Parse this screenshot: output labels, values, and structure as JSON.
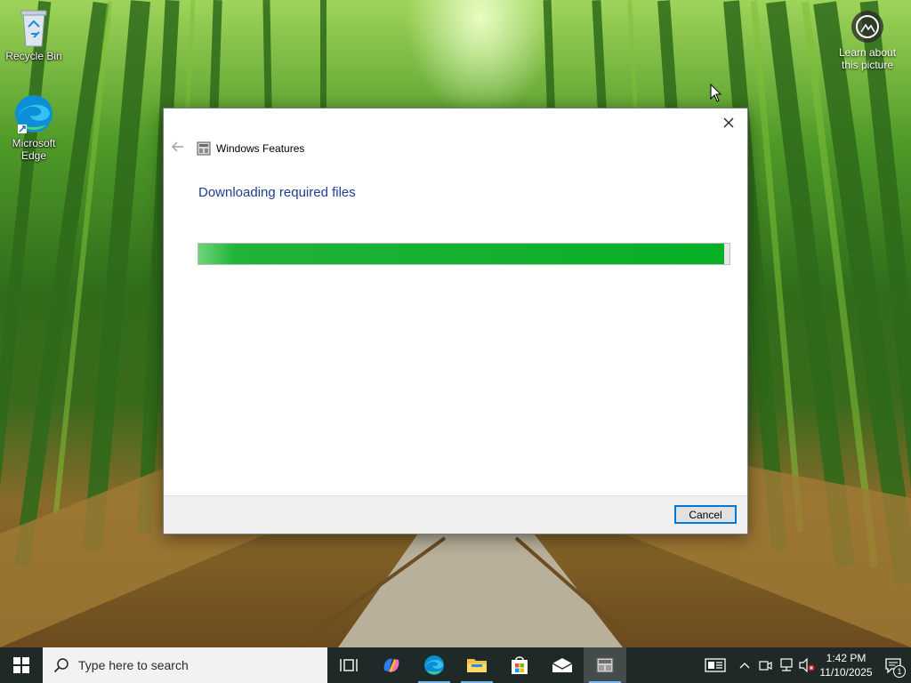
{
  "desktop": {
    "icons": [
      {
        "label": "Recycle Bin"
      },
      {
        "label": "Microsoft Edge"
      }
    ],
    "learn_about_picture": "Learn about this picture"
  },
  "dialog": {
    "title": "Windows Features",
    "heading": "Downloading required files",
    "progress_percent": 99,
    "cancel_label": "Cancel"
  },
  "taskbar": {
    "search_placeholder": "Type here to search",
    "apps": [
      "task-view",
      "copilot",
      "microsoft-edge",
      "file-explorer",
      "microsoft-store",
      "mail",
      "windows-features"
    ],
    "active_app": "windows-features",
    "clock": {
      "time": "1:42 PM",
      "date": "11/10/2025"
    },
    "notification_count": "1"
  },
  "colors": {
    "heading": "#1c3f94",
    "progress": "#06b025",
    "accent": "#0078d7",
    "taskbar": "#1f2a28"
  }
}
